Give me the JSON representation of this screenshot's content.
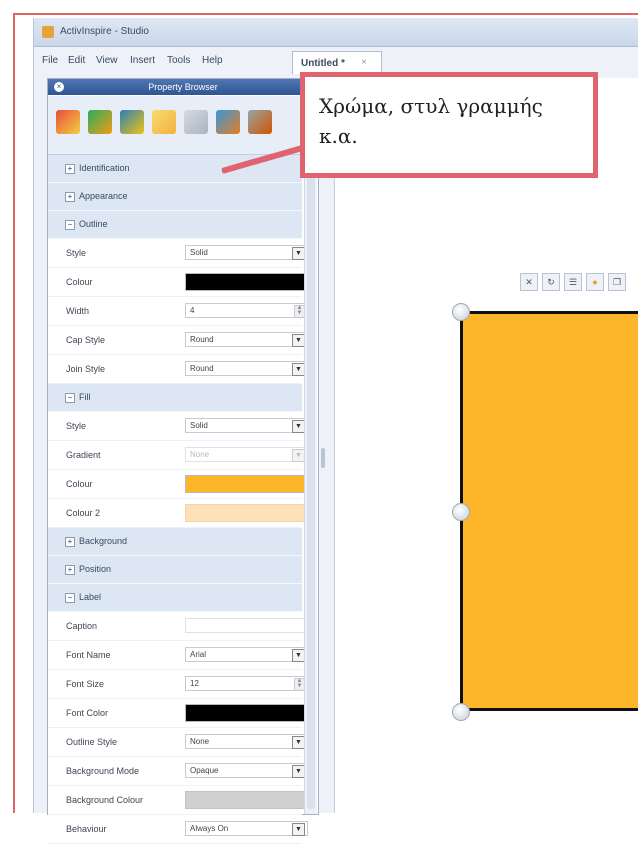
{
  "window": {
    "title": "ActivInspire - Studio"
  },
  "menu": [
    "File",
    "Edit",
    "View",
    "Insert",
    "Tools",
    "Help"
  ],
  "document_tab": {
    "label": "Untitled *",
    "close": "×"
  },
  "panel": {
    "title": "Property Browser",
    "toolbar_icons": [
      "page-browser-icon",
      "resource-browser-icon",
      "notes-icon",
      "object-browser-icon",
      "notes-browser-icon",
      "property-browser-icon",
      "actions-browser-icon"
    ]
  },
  "sections": {
    "identification": {
      "label": "Identification",
      "expander": "+"
    },
    "appearance": {
      "label": "Appearance",
      "expander": "+"
    },
    "outline": {
      "label": "Outline",
      "expander": "−",
      "style": {
        "label": "Style",
        "value": "Solid"
      },
      "colour": {
        "label": "Colour",
        "value": "#000000"
      },
      "width": {
        "label": "Width",
        "value": "4"
      },
      "cap_style": {
        "label": "Cap Style",
        "value": "Round"
      },
      "join_style": {
        "label": "Join Style",
        "value": "Round"
      }
    },
    "fill": {
      "label": "Fill",
      "expander": "−",
      "style": {
        "label": "Style",
        "value": "Solid"
      },
      "gradient": {
        "label": "Gradient",
        "value": "None"
      },
      "colour": {
        "label": "Colour",
        "value": "#fdb52a"
      },
      "colour2": {
        "label": "Colour 2",
        "value": "#fde0b8"
      }
    },
    "background": {
      "label": "Background",
      "expander": "+"
    },
    "position": {
      "label": "Position",
      "expander": "+"
    },
    "label": {
      "label": "Label",
      "expander": "−",
      "caption": {
        "label": "Caption",
        "value": ""
      },
      "font_name": {
        "label": "Font Name",
        "value": "Arial"
      },
      "font_size": {
        "label": "Font Size",
        "value": "12"
      },
      "font_color": {
        "label": "Font Color",
        "value": "#000000"
      },
      "outline_style": {
        "label": "Outline Style",
        "value": "None"
      },
      "background_mode": {
        "label": "Background Mode",
        "value": "Opaque"
      },
      "background_colour": {
        "label": "Background Colour",
        "value": "#d0d0d0"
      },
      "behaviour": {
        "label": "Behaviour",
        "value": "Always On"
      }
    }
  },
  "canvas": {
    "shape_fill": "#fdb52a",
    "toolbar_icons": [
      "delete-icon",
      "rotate-icon",
      "align-icon",
      "color-icon",
      "duplicate-icon"
    ]
  },
  "callout": {
    "text": "Χρώμα, στυλ γραμμής κ.α.",
    "border_color": "#e06470"
  },
  "accent": {
    "frame_red": "#e06666",
    "panel_blue": "#2f5592"
  }
}
